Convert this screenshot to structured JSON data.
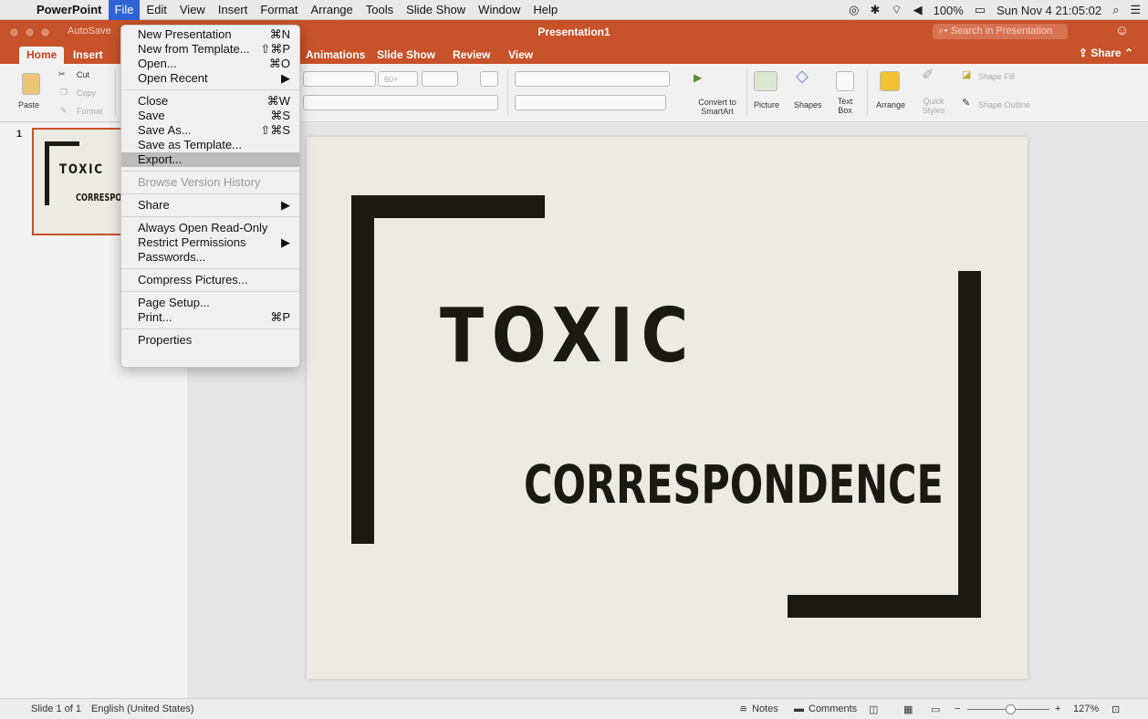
{
  "menubar": {
    "app_name": "PowerPoint",
    "menus": [
      "File",
      "Edit",
      "View",
      "Insert",
      "Format",
      "Arrange",
      "Tools",
      "Slide Show",
      "Window",
      "Help"
    ],
    "battery": "100%",
    "clock": "Sun Nov 4  21:05:02"
  },
  "window": {
    "title": "Presentation1",
    "autosave_label": "AutoSave",
    "search_placeholder": "Search in Presentation"
  },
  "ribbon_tabs": [
    "Home",
    "Insert",
    "Animations",
    "Slide Show",
    "Review",
    "View"
  ],
  "share_label": "Share",
  "ribbon": {
    "paste": "Paste",
    "cut": "Cut",
    "copy": "Copy",
    "format": "Format",
    "font_size": "60+",
    "convert_smartart": "Convert to SmartArt",
    "picture": "Picture",
    "shapes": "Shapes",
    "text_box": "Text Box",
    "arrange": "Arrange",
    "quick_styles": "Quick Styles",
    "shape_fill": "Shape Fill",
    "shape_outline": "Shape Outline"
  },
  "thumbnail": {
    "slide_number": "1",
    "line1": "TOXIC",
    "line2": "CORRESPONDENCE"
  },
  "slide": {
    "title": "TOXIC",
    "subtitle": "CORRESPONDENCE"
  },
  "file_menu": {
    "items": [
      {
        "label": "New Presentation",
        "shortcut": "⌘N"
      },
      {
        "label": "New from Template...",
        "shortcut": "⇧⌘P"
      },
      {
        "label": "Open...",
        "shortcut": "⌘O"
      },
      {
        "label": "Open Recent",
        "shortcut": "▶"
      },
      {
        "label": "Close",
        "shortcut": "⌘W"
      },
      {
        "label": "Save",
        "shortcut": "⌘S"
      },
      {
        "label": "Save As...",
        "shortcut": "⇧⌘S"
      },
      {
        "label": "Save as Template...",
        "shortcut": ""
      },
      {
        "label": "Export...",
        "shortcut": ""
      },
      {
        "label": "Browse Version History",
        "shortcut": ""
      },
      {
        "label": "Share",
        "shortcut": "▶"
      },
      {
        "label": "Always Open Read-Only",
        "shortcut": ""
      },
      {
        "label": "Restrict Permissions",
        "shortcut": "▶"
      },
      {
        "label": "Passwords...",
        "shortcut": ""
      },
      {
        "label": "Compress Pictures...",
        "shortcut": ""
      },
      {
        "label": "Page Setup...",
        "shortcut": ""
      },
      {
        "label": "Print...",
        "shortcut": "⌘P"
      },
      {
        "label": "Properties",
        "shortcut": ""
      }
    ]
  },
  "statusbar": {
    "slide_info": "Slide 1 of 1",
    "language": "English (United States)",
    "notes": "Notes",
    "comments": "Comments",
    "zoom": "127%"
  },
  "colors": {
    "accent": "#c85229",
    "slide_bg": "#ebeae3",
    "slide_ink": "#1a1a12"
  }
}
